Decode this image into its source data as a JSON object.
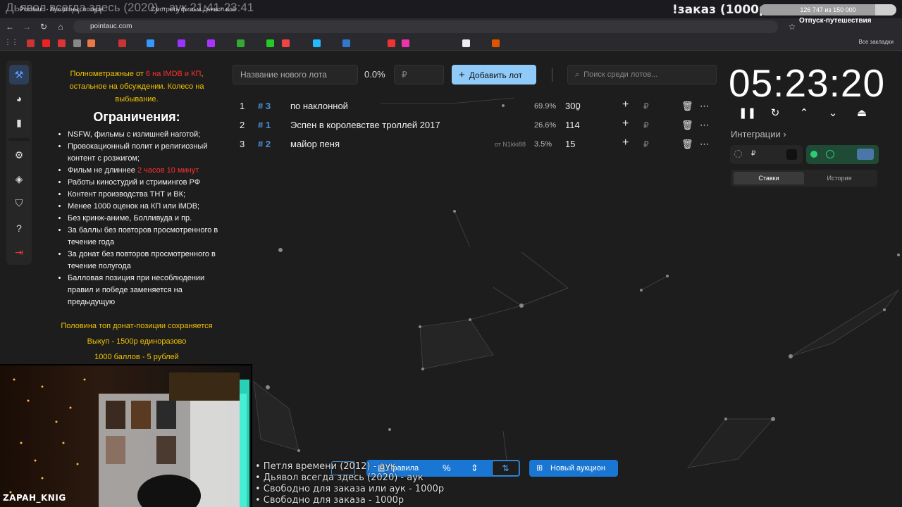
{
  "browser": {
    "tabs": [
      {
        "label": "Pointauc - Аукционы, лотере"
      },
      {
        "label": "Смотреть фильм Дьявол все"
      }
    ],
    "url": "pointauc.com",
    "bookmarks_all": "Все закладки"
  },
  "overlay": {
    "title": "Дьявол всегда здесь (2020) - аук 21:41-23:41",
    "order": "!заказ (1000р)",
    "progress_text": "126 747 из 150 000",
    "progress_fraction": 0.845,
    "vacation": "Отпуск-путешествия"
  },
  "rules": {
    "intro_a": "Полнометражные от ",
    "intro_red": "6 на IMDB и КП",
    "intro_b": ", остальное на обсуждении. Колесо на выбывание.",
    "heading": "Ограничения:",
    "items": [
      "NSFW, фильмы с излишней наготой;",
      "Провокационный полит и религиозный контент с розжигом;",
      "Фильм не длиннее ",
      "Работы киностудий и стримингов РФ",
      "Контент производства ТНТ и ВК;",
      "Менее 1000 оценок на КП или iMDB;",
      "Без кринж-аниме, Болливуда и пр.",
      "За баллы без повторов просмотренного в течение года",
      "За донат без повторов просмотренного в течение полугода",
      "Балловая позиция при несоблюдении правил и победе заменяется на предыдущую"
    ],
    "duration_red": "2 часов 10 минут",
    "footer": [
      "Половина топ донат-позиции сохраняется",
      "Выкуп - 1500р единоразово",
      "1000 баллов - 5 рублей"
    ]
  },
  "lot_form": {
    "name_placeholder": "Название нового лота",
    "percent": "0.0%",
    "amount_placeholder": "₽",
    "add_label": "Добавить лот",
    "search_placeholder": "Поиск среди лотов..."
  },
  "lots": [
    {
      "num": "1",
      "id": "# 3",
      "title": "по наклонной",
      "from": "",
      "pct": "69.9%",
      "amount": "300"
    },
    {
      "num": "2",
      "id": "# 1",
      "title": "Эспен в королевстве троллей 2017",
      "from": "",
      "pct": "26.6%",
      "amount": "114"
    },
    {
      "num": "3",
      "id": "# 2",
      "title": "майор пеня",
      "from": "от N1kki88",
      "pct": "3.5%",
      "amount": "15"
    }
  ],
  "lot_currency": "₽",
  "timer": {
    "value": "05:23:20"
  },
  "integrations": {
    "label": "Интеграции",
    "rub": "₽",
    "tab_bids": "Ставки",
    "tab_history": "История"
  },
  "bottom": {
    "rules_label": "Правила",
    "new_auction_label": "Новый аукцион"
  },
  "queue": [
    "• Петля времени (2012) - аук",
    "• Дьявол всегда здесь (2020) - аук",
    "• Свободно для заказа или аук - 1000р",
    "• Свободно для заказа - 1000р"
  ],
  "webcam": {
    "name": "ZAPAH_KNIG"
  },
  "colors": {
    "accent": "#1976d2",
    "accent_light": "#90caf9",
    "warning": "#f2c200",
    "danger": "#ff3030"
  }
}
